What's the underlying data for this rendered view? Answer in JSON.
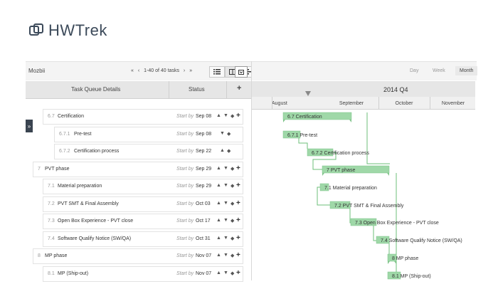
{
  "brand": {
    "logo_text": "HWTrek"
  },
  "toolbar": {
    "project": "Mozbii",
    "first": "«",
    "prev": "‹",
    "page_info": "1-40 of 40 tasks",
    "next": "›",
    "last": "»",
    "view_icons": [
      "list-view-icon",
      "split-view-icon",
      "gantt-view-icon"
    ],
    "collapse_icon": "collapse-panel-icon"
  },
  "scale": {
    "day": "Day",
    "week": "Week",
    "month": "Month",
    "active": "Month"
  },
  "table_header": {
    "details": "Task Queue Details",
    "status": "Status",
    "add": "+"
  },
  "timeline": {
    "quarter": "2014  Q4",
    "months": [
      "August",
      "September",
      "October",
      "November"
    ]
  },
  "side_tab": "»",
  "start_by_label": "Start by",
  "tasks": [
    {
      "num": "6.7",
      "name": "Certification",
      "date": "Sep 08",
      "level": 1,
      "controls": "full"
    },
    {
      "num": "6.7.1",
      "name": "Pre-test",
      "date": "Sep 08",
      "level": 2,
      "controls": "down"
    },
    {
      "num": "6.7.2",
      "name": "Certification process",
      "date": "Sep 22",
      "level": 2,
      "controls": "up"
    },
    {
      "num": "7",
      "name": "PVT phase",
      "date": "Sep 29",
      "level": 0,
      "controls": "full"
    },
    {
      "num": "7.1",
      "name": "Material preparation",
      "date": "Sep 29",
      "level": 1,
      "controls": "full"
    },
    {
      "num": "7.2",
      "name": "PVT SMT & Final Assembly",
      "date": "Oct 03",
      "level": 1,
      "controls": "full"
    },
    {
      "num": "7.3",
      "name": "Open Box Experience - PVT close",
      "date": "Oct 17",
      "level": 1,
      "controls": "full"
    },
    {
      "num": "7.4",
      "name": "Software Qualify Notice (SW/QA)",
      "date": "Oct 31",
      "level": 1,
      "controls": "full"
    },
    {
      "num": "8",
      "name": "MP phase",
      "date": "Nov 07",
      "level": 0,
      "controls": "full"
    },
    {
      "num": "8.1",
      "name": "MP (Ship-out)",
      "date": "Nov 07",
      "level": 1,
      "controls": "full"
    }
  ],
  "gantt_labels": [
    "6.7 Certification",
    "6.7.1 Pre-test",
    "6.7.2 Certification process",
    "7 PVT phase",
    "7.1 Material preparation",
    "7.2 PVT SMT & Final Assembly",
    "7.3 Open Box Experience - PVT close",
    "7.4 Software Qualify Notice (SW/QA)",
    "8 MP phase",
    "8.1 MP (Ship-out)"
  ],
  "colors": {
    "bar": "#9fd8a8",
    "bar_border": "#7fc48a",
    "link": "#6cbf7a",
    "header": "#e6e6e6",
    "dark_tab": "#3a4450"
  }
}
